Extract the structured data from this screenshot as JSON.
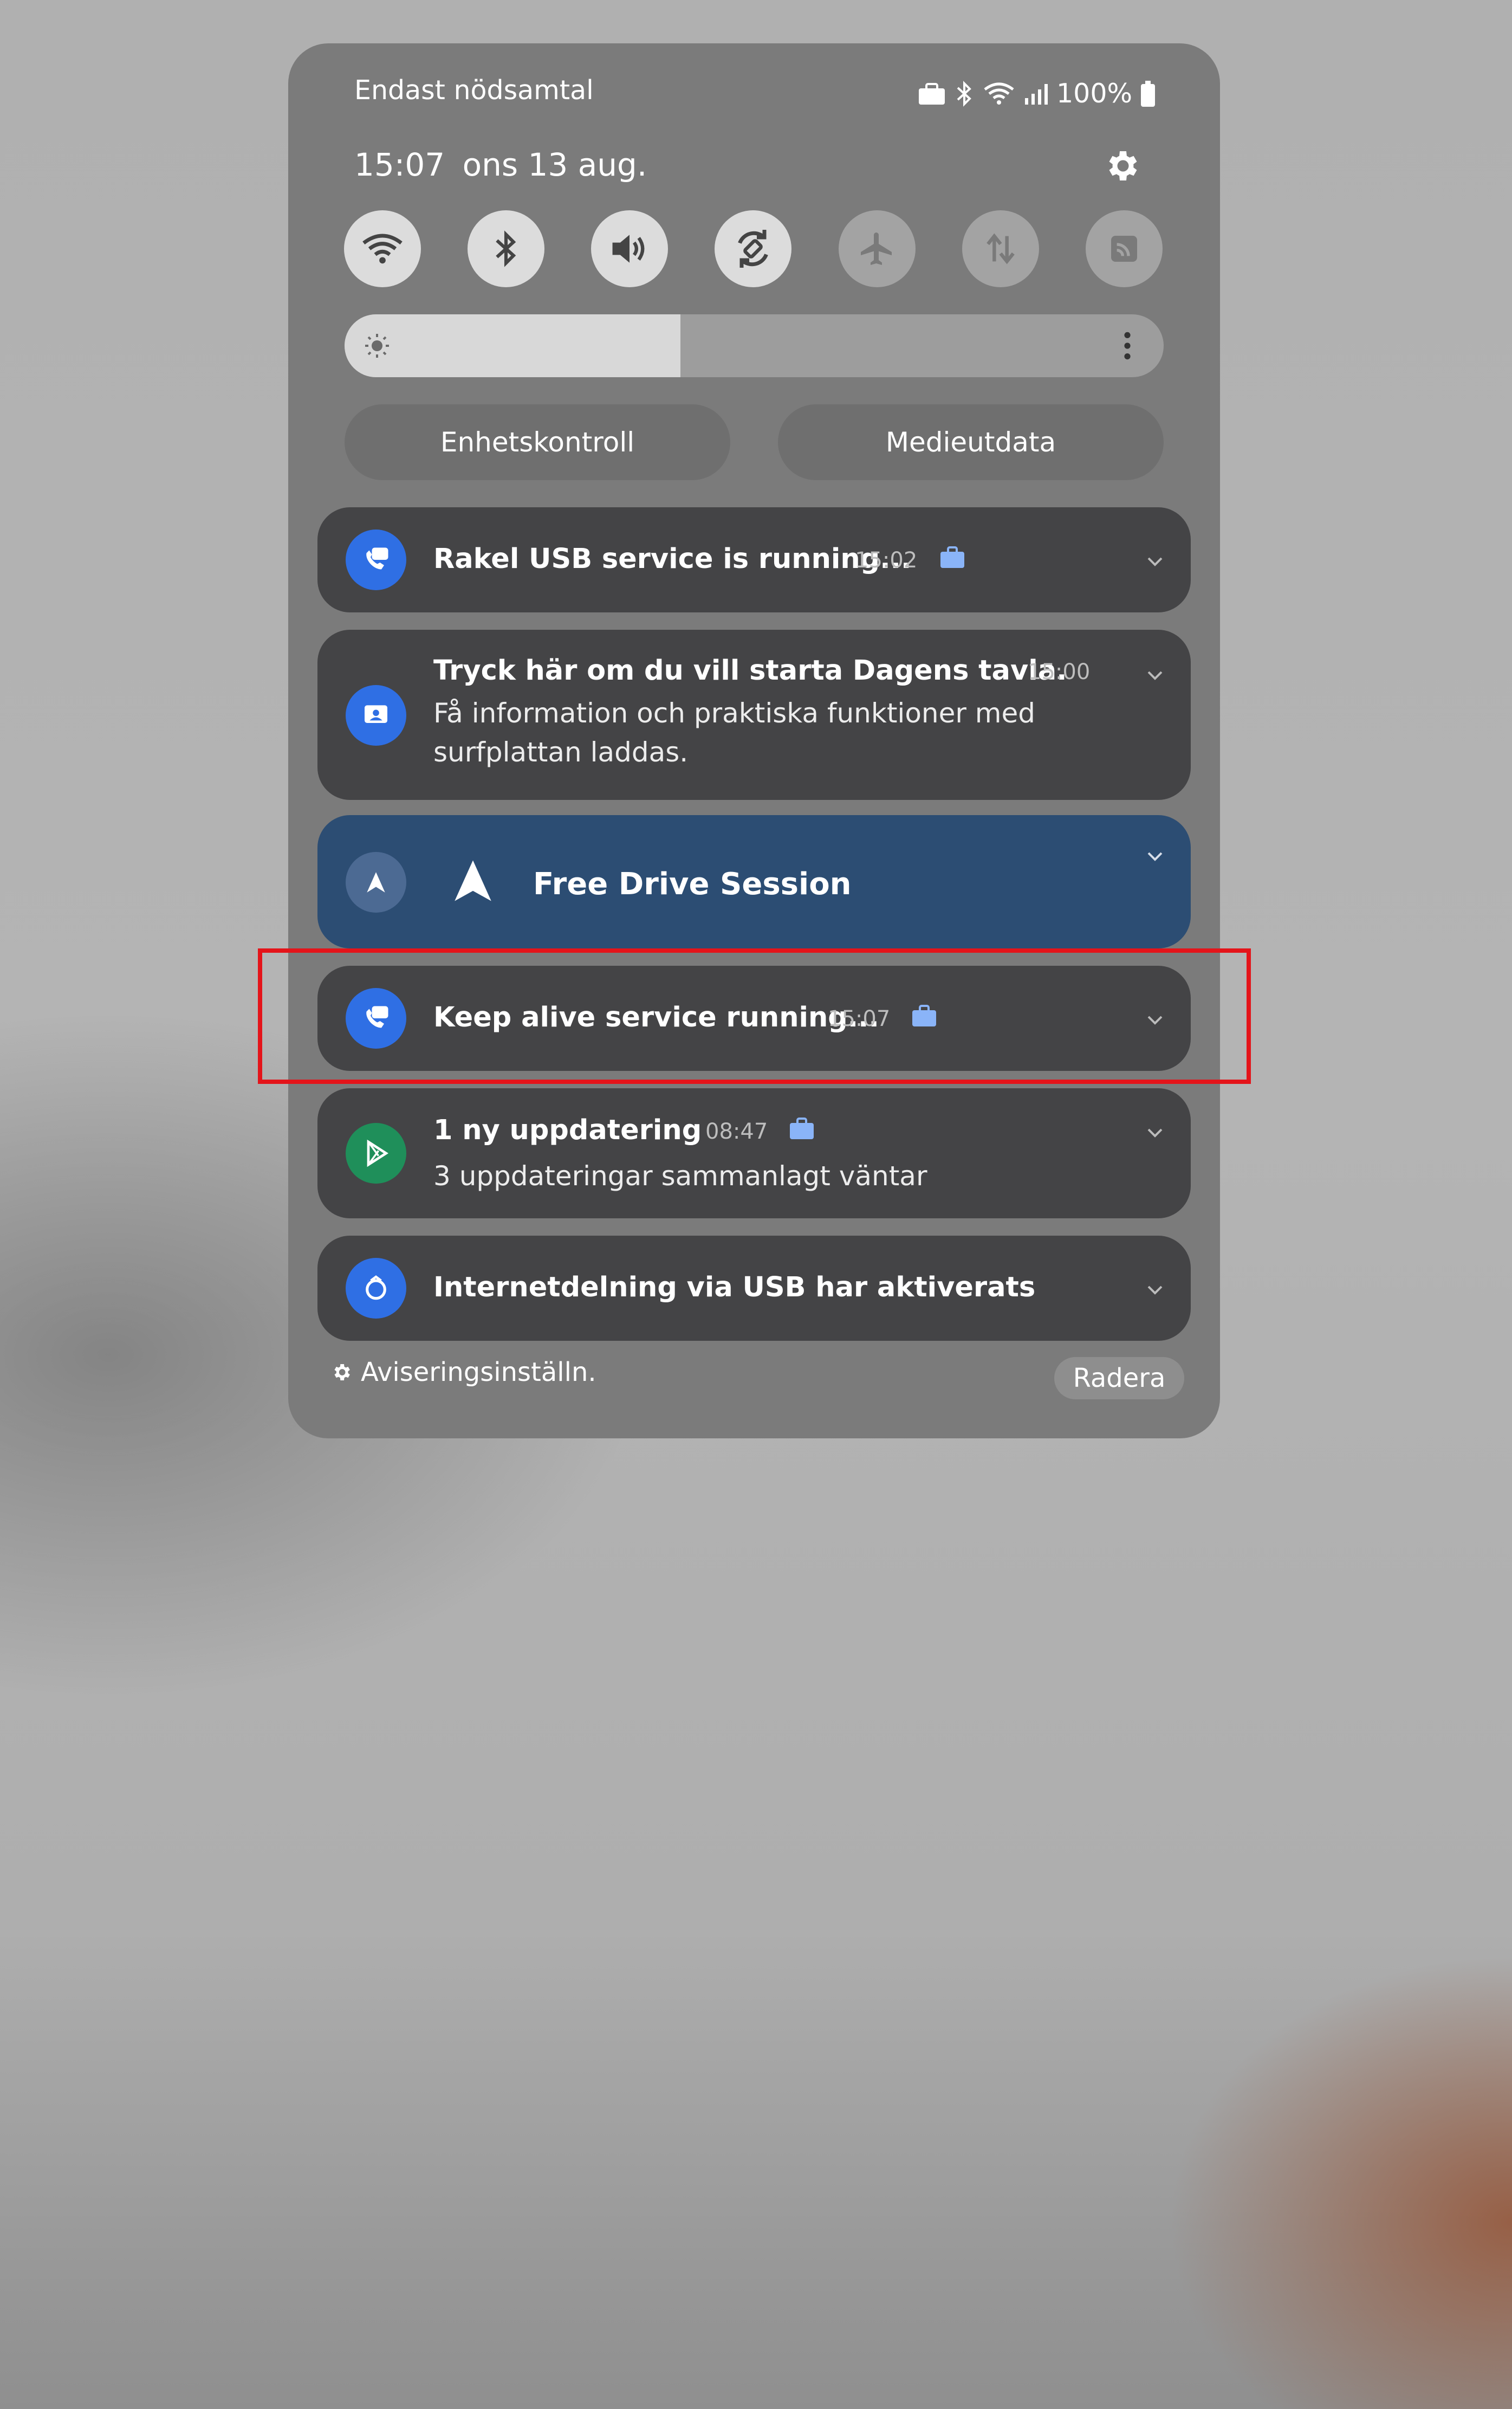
{
  "status_bar": {
    "carrier": "Endast nödsamtal",
    "battery": "100%",
    "icons": [
      "briefcase-icon",
      "bluetooth-icon",
      "wifi-icon",
      "signal-icon",
      "battery-icon"
    ]
  },
  "header": {
    "time": "15:07",
    "date": "ons 13 aug.",
    "settings_icon": "gear-icon"
  },
  "quick_settings": [
    {
      "name": "wifi",
      "icon": "wifi-icon",
      "active": true
    },
    {
      "name": "bluetooth",
      "icon": "bluetooth-icon",
      "active": true
    },
    {
      "name": "sound",
      "icon": "volume-icon",
      "active": true
    },
    {
      "name": "auto-rotate",
      "icon": "rotate-icon",
      "active": true
    },
    {
      "name": "airplane",
      "icon": "airplane-icon",
      "active": false
    },
    {
      "name": "mobile-data",
      "icon": "data-transfer-icon",
      "active": false
    },
    {
      "name": "cast",
      "icon": "cast-icon",
      "active": false
    }
  ],
  "brightness": {
    "level": 0.41
  },
  "buttons": {
    "device_control": "Enhetskontroll",
    "media_output": "Medieutdata"
  },
  "notifications": [
    {
      "id": "rakel",
      "title": "Rakel USB service is running...",
      "time": "15:02",
      "icon": "phone-app-icon",
      "work_badge": true
    },
    {
      "id": "dagens",
      "title": "Tryck här om du vill starta Dagens tavla.",
      "time": "15:00",
      "body": "Få information och praktiska funktioner med surfplattan laddas.",
      "icon": "display-app-icon"
    },
    {
      "id": "drive",
      "title": "Free Drive Session",
      "icon": "navigation-icon"
    },
    {
      "id": "keepalive",
      "title": "Keep alive service running...",
      "time": "15:07",
      "icon": "phone-app-icon",
      "work_badge": true
    },
    {
      "id": "update",
      "title": "1 ny uppdatering",
      "time": "08:47",
      "body": "3 uppdateringar sammanlagt väntar",
      "icon": "play-store-icon",
      "work_badge": true
    },
    {
      "id": "tether",
      "title": "Internetdelning via USB har aktiverats",
      "icon": "usb-tether-icon"
    }
  ],
  "footer": {
    "settings_label": "Aviseringsinställn.",
    "clear_label": "Radera"
  },
  "colors": {
    "panel": "#7b7b7b",
    "card": "#444446",
    "drive_card": "#2c4d73",
    "app_blue": "#2f6fe4",
    "app_green": "#1f8f5a",
    "work_badge": "#8ab4f8",
    "highlight": "#e4141a"
  }
}
